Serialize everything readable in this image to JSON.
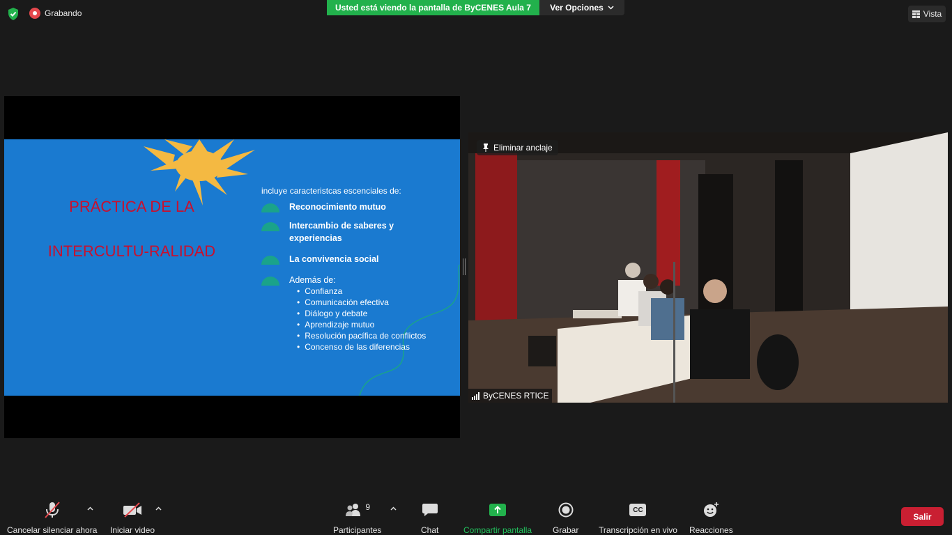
{
  "top_bar": {
    "recording_label": "Grabando",
    "share_banner": "Usted está viendo la pantalla de ByCENES Aula 7",
    "view_options_label": "Ver Opciones",
    "view_label": "Vista"
  },
  "slide": {
    "title_line1": "PRÁCTICA DE LA",
    "title_line2": "INTERCULTU-RALIDAD",
    "lead": "incluye caracteristcas escenciales de:",
    "bullets": [
      "Reconocimiento mutuo",
      "Intercambio de saberes y experiencias",
      "La convivencia social",
      "Además de:"
    ],
    "sub_items": [
      "Confianza",
      "Comunicación efectiva",
      "Diálogo y debate",
      "Aprendizaje mutuo",
      "Resolución pacífica de conflictos",
      "Concenso de las diferencias"
    ]
  },
  "video": {
    "unpin_label": "Eliminar anclaje",
    "participant_name": "ByCENES RTICE"
  },
  "toolbar": {
    "mute_label": "Cancelar silenciar ahora",
    "video_label": "Iniciar video",
    "participants_label": "Participantes",
    "participants_count": "9",
    "chat_label": "Chat",
    "share_label": "Compartir pantalla",
    "record_label": "Grabar",
    "transcript_label": "Transcripción en vivo",
    "reactions_label": "Reacciones",
    "cc_label": "CC",
    "leave_label": "Salir"
  },
  "colors": {
    "share_banner": "#22b14c",
    "slide_bg": "#1a7ad0",
    "slide_title": "#c8102e",
    "leave_button": "#c91f32"
  }
}
